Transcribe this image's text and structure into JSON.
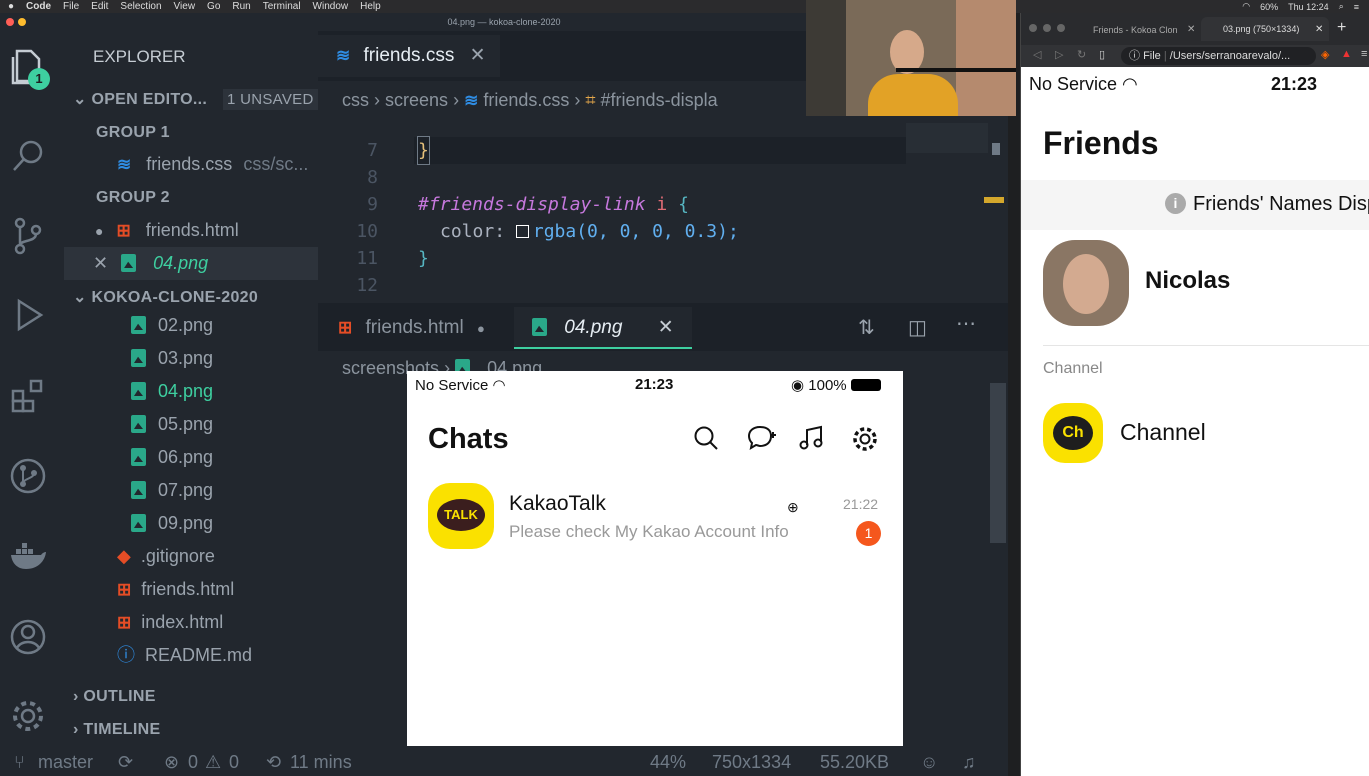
{
  "menubar": {
    "app": "Code",
    "items": [
      "File",
      "Edit",
      "Selection",
      "View",
      "Go",
      "Run",
      "Terminal",
      "Window",
      "Help"
    ],
    "battery": "60%",
    "clock": "Thu 12:24"
  },
  "vscode": {
    "window_title": "04.png — kokoa-clone-2020",
    "activity_badge": "1",
    "sidebar": {
      "title": "EXPLORER",
      "open_editors": "OPEN EDITO...",
      "unsaved": "1 UNSAVED",
      "group1": "GROUP 1",
      "group1_file": "friends.css",
      "group1_path": "css/sc...",
      "group2": "GROUP 2",
      "group2_file1": "friends.html",
      "group2_file2": "04.png",
      "project": "KOKOA-CLONE-2020",
      "files": [
        "02.png",
        "03.png",
        "04.png",
        "05.png",
        "06.png",
        "07.png",
        "09.png"
      ],
      "gitignore": ".gitignore",
      "friends_html": "friends.html",
      "index_html": "index.html",
      "readme": "README.md",
      "outline": "OUTLINE",
      "timeline": "TIMELINE"
    },
    "editor_top": {
      "tab": "friends.css",
      "breadcrumb": [
        "css",
        "screens",
        "friends.css",
        "#friends-displa"
      ],
      "lines": [
        {
          "n": "7",
          "text": "}"
        },
        {
          "n": "8",
          "text": ""
        },
        {
          "n": "9",
          "sel": "#friends-display-link",
          "el": "i",
          "brace": "{"
        },
        {
          "n": "10",
          "prop": "color",
          "val": "rgba(0, 0, 0, 0.3);"
        },
        {
          "n": "11",
          "text": "}"
        },
        {
          "n": "12",
          "text": ""
        }
      ]
    },
    "editor_bottom": {
      "tab1": "friends.html",
      "tab2": "04.png",
      "breadcrumb": [
        "screenshots",
        "04.png"
      ]
    },
    "status": {
      "branch": "master",
      "errors": "0",
      "warnings": "0",
      "time": "11 mins",
      "zoom": "44%",
      "size": "750x1334",
      "filesize": "55.20KB"
    }
  },
  "phone_preview": {
    "carrier": "No Service",
    "time": "21:23",
    "battery": "100%",
    "title": "Chats",
    "chat": {
      "name": "KakaoTalk",
      "message": "Please check My Kakao Account Info",
      "time": "21:22",
      "badge": "1",
      "logo": "TALK"
    }
  },
  "browser": {
    "tab1": "Friends - Kokoa Clon",
    "tab2": "03.png (750×1334)",
    "address_label": "File",
    "address": "/Users/serranoarevalo/...",
    "carrier": "No Service",
    "time": "21:23",
    "title": "Friends",
    "banner": "Friends' Names Disp",
    "profile_name": "Nicolas",
    "channel_label": "Channel",
    "channel_name": "Channel",
    "channel_logo": "Ch"
  },
  "colors": {
    "kakao_yellow": "#fae100",
    "badge_orange": "#f5571d",
    "css_blue": "#2f8de4",
    "html_orange": "#e44d26",
    "png_green": "#2aa889",
    "editor_bg": "#22272e"
  }
}
